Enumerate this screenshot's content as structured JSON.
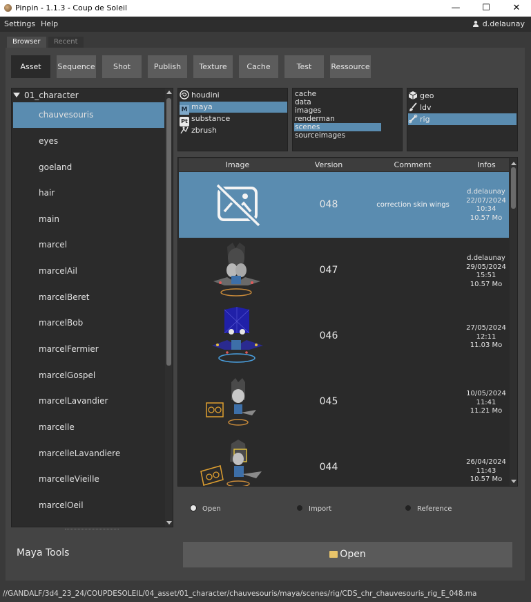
{
  "window": {
    "title": "Pinpin - 1.1.3 - Coup de Soleil",
    "controls": {
      "minimize": "—",
      "maximize": "☐",
      "close": "✕"
    }
  },
  "menu": {
    "items": [
      "Settings",
      "Help"
    ],
    "user": "d.delaunay"
  },
  "tabs": [
    {
      "label": "Browser",
      "active": true
    },
    {
      "label": "Recent",
      "active": false
    }
  ],
  "categories": [
    "Asset",
    "Sequence",
    "Shot",
    "Publish",
    "Texture",
    "Cache",
    "Test",
    "Ressource"
  ],
  "active_category": "Asset",
  "asset_tree": {
    "root": "01_character",
    "items": [
      "chauvesouris",
      "eyes",
      "goeland",
      "hair",
      "main",
      "marcel",
      "marcelAil",
      "marcelBeret",
      "marcelBob",
      "marcelFermier",
      "marcelGospel",
      "marcelLavandier",
      "marcelle",
      "marcelleLavandiere",
      "marcelleVieille",
      "marcelOeil"
    ],
    "selected": "chauvesouris"
  },
  "software": {
    "items": [
      {
        "label": "houdini",
        "icon": "houdini-icon"
      },
      {
        "label": "maya",
        "icon": "maya-icon",
        "badge": "M"
      },
      {
        "label": "substance",
        "icon": "substance-icon",
        "badge": "Pt"
      },
      {
        "label": "zbrush",
        "icon": "zbrush-icon"
      }
    ],
    "selected": "maya"
  },
  "folders": {
    "items": [
      "cache",
      "data",
      "images",
      "renderman",
      "scenes",
      "sourceimages"
    ],
    "selected": "scenes"
  },
  "steps": {
    "items": [
      {
        "label": "geo",
        "icon": "cube-icon"
      },
      {
        "label": "ldv",
        "icon": "brush-icon"
      },
      {
        "label": "rig",
        "icon": "bone-icon"
      }
    ],
    "selected": "rig"
  },
  "versions": {
    "columns": [
      "Image",
      "Version",
      "Comment",
      "Infos"
    ],
    "rows": [
      {
        "version": "048",
        "comment": "correction skin wings",
        "info": [
          "d.delaunay",
          "22/07/2024",
          "10:34",
          "10.57 Mo"
        ],
        "thumb": "no-image-icon",
        "selected": true
      },
      {
        "version": "047",
        "comment": "",
        "info": [
          "d.delaunay",
          "29/05/2024",
          "15:51",
          "10.57 Mo"
        ],
        "thumb": "rig-preview-gray",
        "selected": false
      },
      {
        "version": "046",
        "comment": "",
        "info": [
          "27/05/2024",
          "12:11",
          "11.03 Mo"
        ],
        "thumb": "rig-preview-blue",
        "selected": false
      },
      {
        "version": "045",
        "comment": "",
        "info": [
          "10/05/2024",
          "11:41",
          "11.21 Mo"
        ],
        "thumb": "rig-preview-eyes",
        "selected": false
      },
      {
        "version": "044",
        "comment": "",
        "info": [
          "26/04/2024",
          "11:43",
          "10.57 Mo"
        ],
        "thumb": "rig-preview-eyes-2",
        "selected": false
      }
    ]
  },
  "open_mode": {
    "options": [
      "Open",
      "Import",
      "Reference"
    ],
    "selected": "Open"
  },
  "footer": {
    "tools_label": "Maya Tools",
    "open_button": "Open"
  },
  "status_path": "//GANDALF/3d4_23_24/COUPDESOLEIL/04_asset/01_character/chauvesouris/maya/scenes/rig/CDS_chr_chauvesouris_rig_E_048.ma",
  "colors": {
    "selection": "#5a8cb0",
    "panel": "#2b2b2b",
    "background": "#444444",
    "button": "#5c5c5c"
  }
}
